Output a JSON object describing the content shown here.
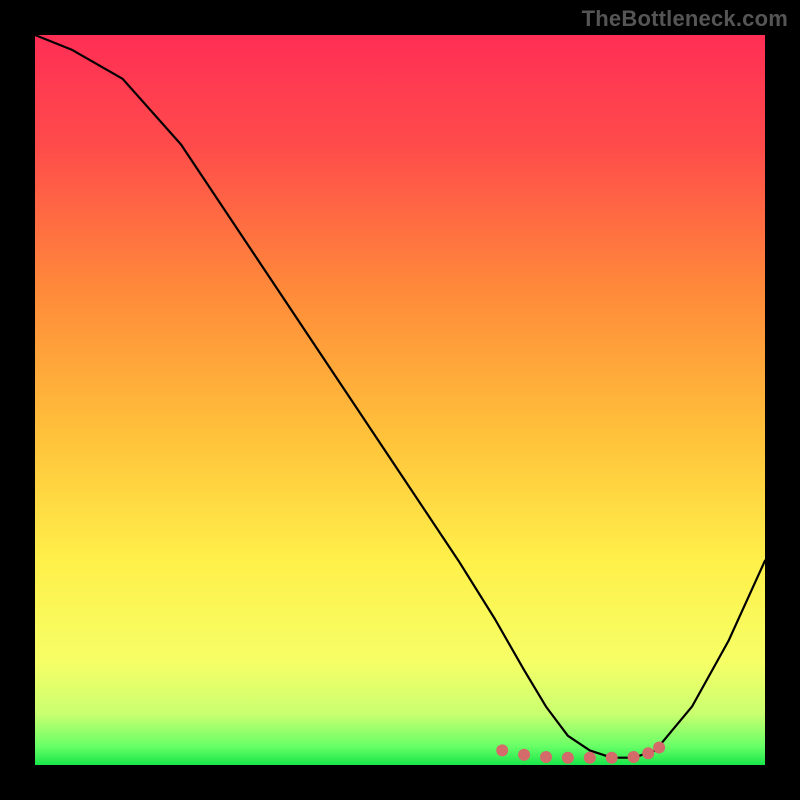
{
  "watermark": "TheBottleneck.com",
  "chart_data": {
    "type": "line",
    "title": "",
    "xlabel": "",
    "ylabel": "",
    "xlim": [
      0,
      100
    ],
    "ylim": [
      0,
      100
    ],
    "grid": false,
    "legend": false,
    "series": [
      {
        "name": "curve",
        "x": [
          0,
          5,
          12,
          20,
          30,
          40,
          50,
          58,
          63,
          67,
          70,
          73,
          76,
          79,
          82,
          85,
          90,
          95,
          100
        ],
        "y": [
          100,
          98,
          94,
          85,
          70,
          55,
          40,
          28,
          20,
          13,
          8,
          4,
          2,
          1,
          1,
          2,
          8,
          17,
          28
        ]
      }
    ],
    "markers": {
      "name": "flat-bottom-dots",
      "color": "#d46a6a",
      "radius": 6,
      "points": [
        {
          "x": 64,
          "y": 2.0
        },
        {
          "x": 67,
          "y": 1.4
        },
        {
          "x": 70,
          "y": 1.1
        },
        {
          "x": 73,
          "y": 1.0
        },
        {
          "x": 76,
          "y": 1.0
        },
        {
          "x": 79,
          "y": 1.0
        },
        {
          "x": 82,
          "y": 1.1
        },
        {
          "x": 84,
          "y": 1.6
        },
        {
          "x": 85.5,
          "y": 2.4
        }
      ]
    },
    "background_gradient": {
      "direction": "vertical",
      "stops": [
        {
          "offset": 0.0,
          "color": "#ff2e55"
        },
        {
          "offset": 0.15,
          "color": "#ff4b4b"
        },
        {
          "offset": 0.35,
          "color": "#ff8a3a"
        },
        {
          "offset": 0.55,
          "color": "#ffc23a"
        },
        {
          "offset": 0.72,
          "color": "#fff04a"
        },
        {
          "offset": 0.86,
          "color": "#f6ff66"
        },
        {
          "offset": 0.93,
          "color": "#c9ff70"
        },
        {
          "offset": 0.975,
          "color": "#66ff66"
        },
        {
          "offset": 1.0,
          "color": "#19e64a"
        }
      ]
    }
  }
}
